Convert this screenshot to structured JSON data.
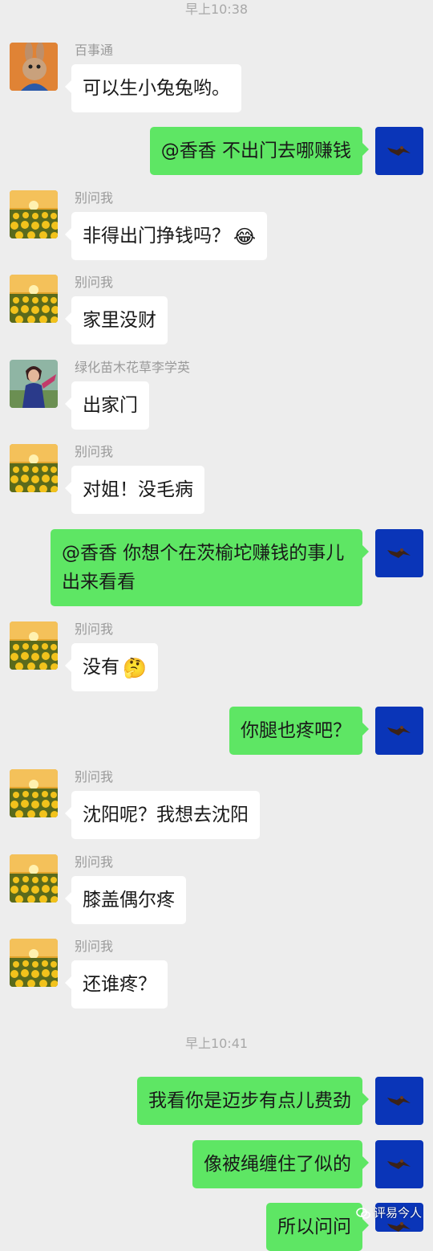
{
  "timestamps": [
    "早上10:38",
    "早上10:41"
  ],
  "messages": [
    {
      "sender": "百事通",
      "text": "可以生小兔兔哟。"
    },
    {
      "text": "@香香  不出门去哪赚钱"
    },
    {
      "sender": "别问我",
      "text": "非得出门挣钱吗？",
      "emoji": "😂"
    },
    {
      "sender": "别问我",
      "text": "家里没财"
    },
    {
      "sender": "绿化苗木花草李学英",
      "text": "出家门"
    },
    {
      "sender": "别问我",
      "text": "对姐！没毛病"
    },
    {
      "text": "@香香  你想个在茨榆坨赚钱的事儿出来看看"
    },
    {
      "sender": "别问我",
      "text": "没有",
      "emoji": "🤔"
    },
    {
      "text": "你腿也疼吧？"
    },
    {
      "sender": "别问我",
      "text": "沈阳呢？我想去沈阳"
    },
    {
      "sender": "别问我",
      "text": "膝盖偶尔疼"
    },
    {
      "sender": "别问我",
      "text": "还谁疼？"
    },
    {
      "text": "我看你是迈步有点儿费劲"
    },
    {
      "text": "像被绳缠住了似的"
    },
    {
      "text": "所以问问"
    }
  ],
  "watermark": {
    "text": "评易今人",
    "icon": "wechat-channel-icon"
  },
  "colors": {
    "background": "#ededed",
    "incoming_bubble": "#ffffff",
    "outgoing_bubble": "#5ee664",
    "timestamp": "#a8a8a8",
    "sender_name": "#9a9a9a",
    "self_avatar_bg": "#0a35b8"
  }
}
